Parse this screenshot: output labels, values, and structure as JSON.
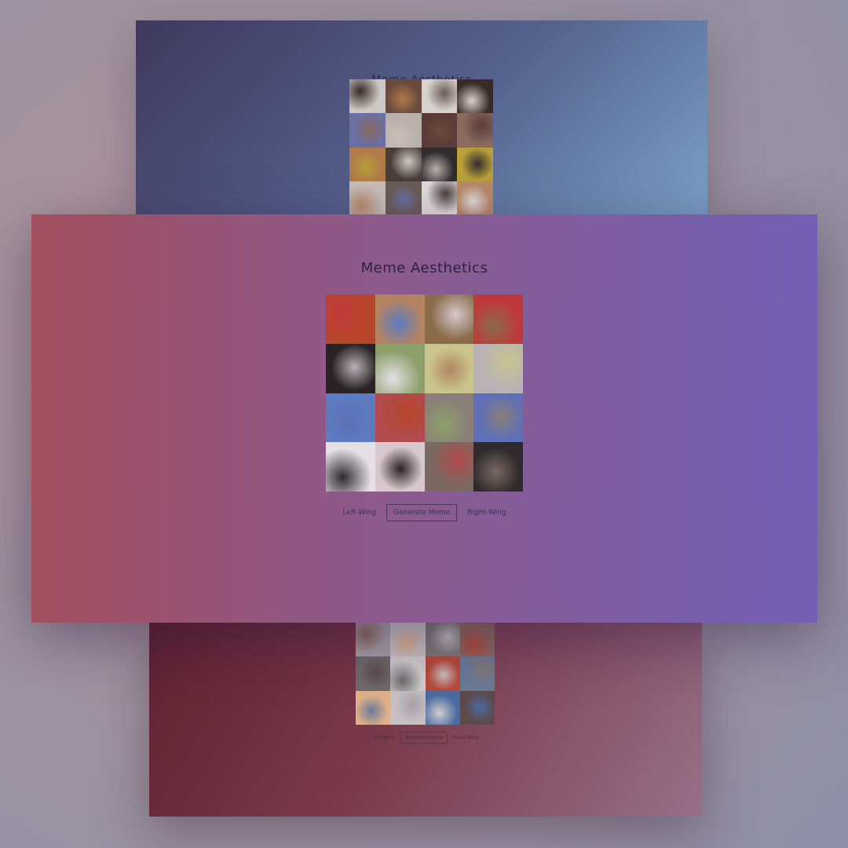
{
  "panels": {
    "top": {
      "title": "Meme Aesthetics",
      "tiles": [
        "#cfc9c6",
        "#6b4a3e",
        "#d8d2cf",
        "#3a2a26",
        "#6a6fa5",
        "#b8b0aa",
        "#5a3b38",
        "#8a6b5e",
        "#b07a4a",
        "#4a3d3a",
        "#2f2b2e",
        "#b9a03a",
        "#c9bfb8",
        "#6a5d55",
        "#e2dede",
        "#b88a6a"
      ]
    },
    "main": {
      "title": "Meme Aesthetics",
      "tiles": [
        "#b8452a",
        "#b38462",
        "#8a6b4a",
        "#c0393a",
        "#2a2224",
        "#8da06a",
        "#c9c48c",
        "#b8b2b6",
        "#5c7bc0",
        "#b04a4c",
        "#8a7f78",
        "#5e6fb5",
        "#e4e0e6",
        "#d6c8cc",
        "#7a6a62",
        "#2e2a2c"
      ],
      "controls": {
        "left_label": "Left-Wing",
        "generate_label": "Generate Meme",
        "right_label": "Right-Wing"
      }
    },
    "bottom": {
      "tiles": [
        "#a8a0a6",
        "#c8c2c4",
        "#7e7a78",
        "#8c6a5e",
        "#6e6a6c",
        "#d0cccc",
        "#b84a3a",
        "#6a7a98",
        "#e0b08a",
        "#c6c0c4",
        "#4a6aa0",
        "#5e4a4a"
      ],
      "controls": {
        "left_label": "Left-Wing",
        "generate_label": "Generate Meme",
        "right_label": "Right-Wing"
      }
    }
  }
}
